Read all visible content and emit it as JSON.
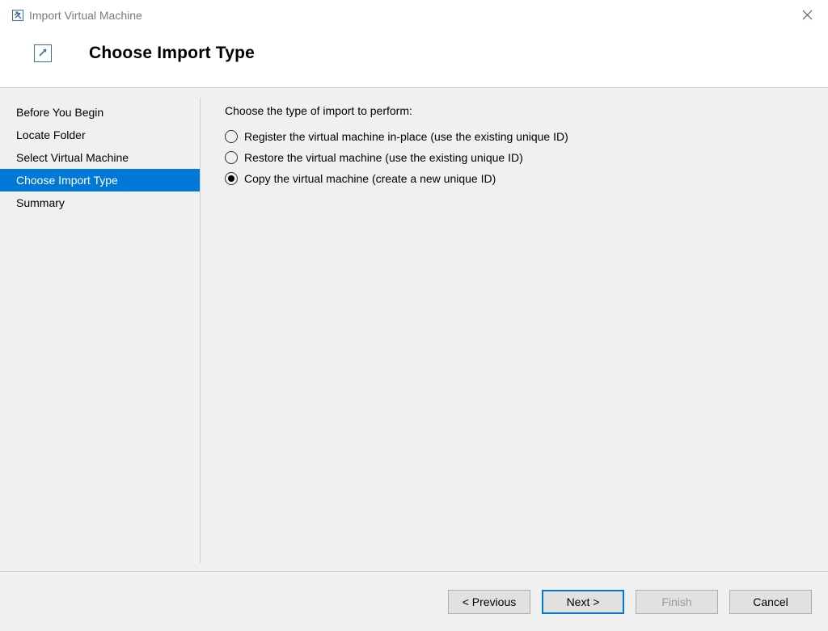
{
  "titlebar": {
    "title": "Import Virtual Machine"
  },
  "header": {
    "title": "Choose Import Type"
  },
  "sidebar": {
    "items": [
      {
        "label": "Before You Begin",
        "active": false
      },
      {
        "label": "Locate Folder",
        "active": false
      },
      {
        "label": "Select Virtual Machine",
        "active": false
      },
      {
        "label": "Choose Import Type",
        "active": true
      },
      {
        "label": "Summary",
        "active": false
      }
    ]
  },
  "content": {
    "instruction": "Choose the type of import to perform:",
    "options": [
      {
        "label": "Register the virtual machine in-place (use the existing unique ID)",
        "selected": false
      },
      {
        "label": "Restore the virtual machine (use the existing unique ID)",
        "selected": false
      },
      {
        "label": "Copy the virtual machine (create a new unique ID)",
        "selected": true
      }
    ]
  },
  "footer": {
    "previous": "< Previous",
    "next": "Next >",
    "finish": "Finish",
    "cancel": "Cancel"
  }
}
